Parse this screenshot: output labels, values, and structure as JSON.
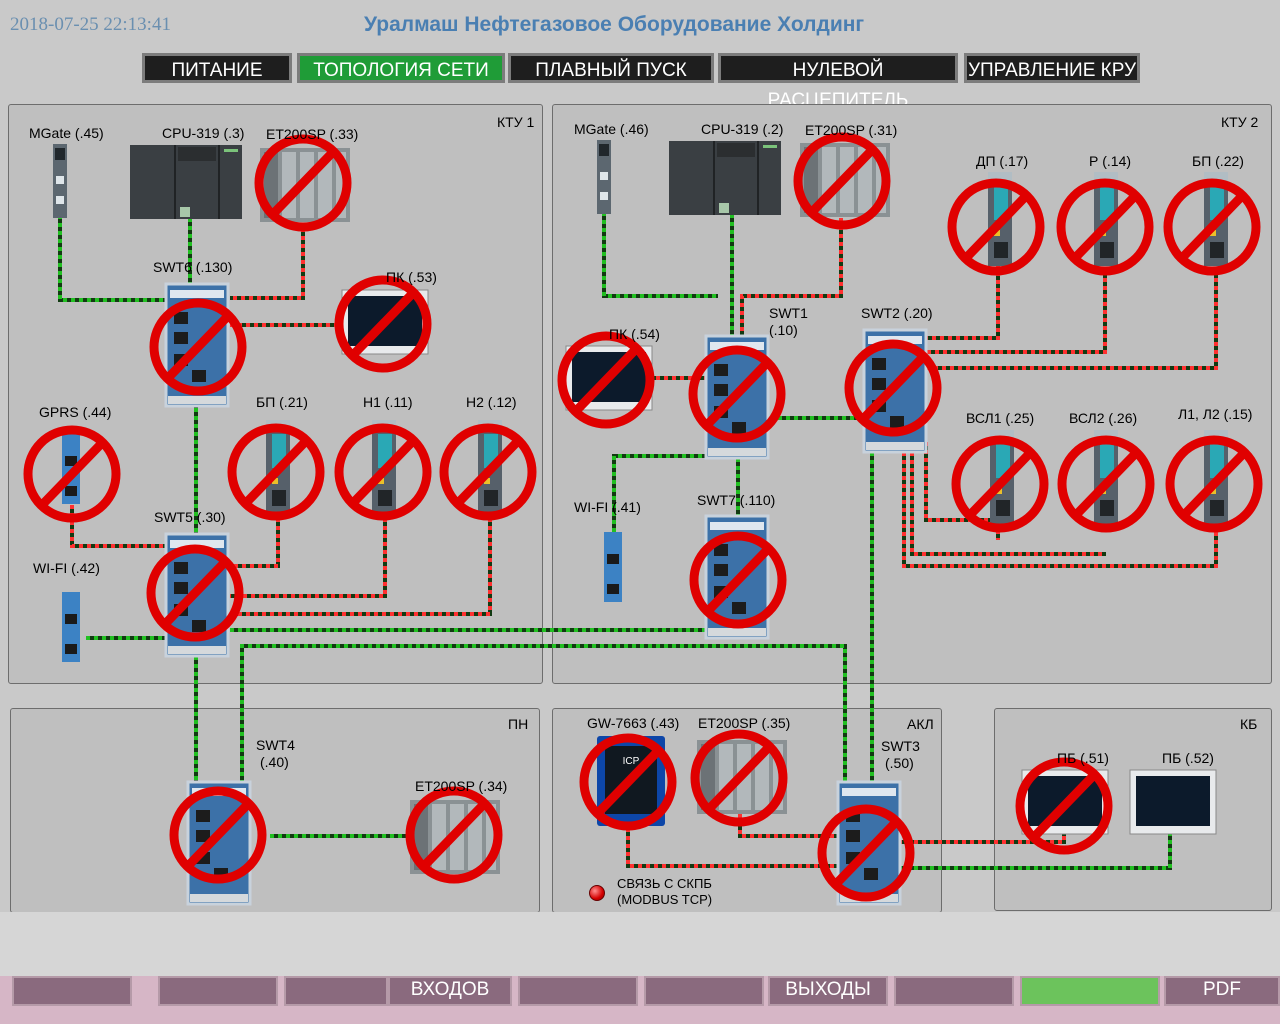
{
  "header": {
    "datetime": "2018-07-25 22:13:41",
    "title": "Уралмаш Нефтегазовое Оборудование Холдинг"
  },
  "nav": [
    {
      "label": "ПИТАНИЕ",
      "active": false
    },
    {
      "label": "ТОПОЛОГИЯ СЕТИ",
      "active": true
    },
    {
      "label": "ПЛАВНЫЙ ПУСК",
      "active": false
    },
    {
      "label": "НУЛЕВОЙ РАСЦЕПИТЕЛЬ",
      "active": false
    },
    {
      "label": "УПРАВЛЕНИЕ КРУ",
      "active": false
    }
  ],
  "panels": {
    "ktu1": "КТУ 1",
    "ktu2": "КТУ 2",
    "pn": "ПН",
    "akl": "АКЛ",
    "kb": "КБ"
  },
  "devices": {
    "mgate45": "MGate (.45)",
    "cpu3": "CPU-319 (.3)",
    "et33": "ET200SP (.33)",
    "swt6": "SWT6   (.130)",
    "pk53": "ПК (.53)",
    "gprs": "GPRS (.44)",
    "bp21": "БП (.21)",
    "h1": "Н1 (.11)",
    "h2": "Н2 (.12)",
    "swt5": "SWT5   (.30)",
    "wifi42": "WI-FI (.42)",
    "mgate46": "MGate (.46)",
    "cpu2": "CPU-319 (.2)",
    "et31": "ET200SP (.31)",
    "dp17": "ДП (.17)",
    "p14": "Р (.14)",
    "bp22": "БП (.22)",
    "pk54": "ПК (.54)",
    "swt1a": "SWT1",
    "swt1b": "(.10)",
    "swt2": "SWT2 (.20)",
    "vsl1": "ВСЛ1 (.25)",
    "vsl2": "ВСЛ2 (.26)",
    "l12": "Л1, Л2 (.15)",
    "wifi41": "WI-FI  (.41)",
    "swt7": "SWT7   (.110)",
    "swt4a": "SWT4",
    "swt4b": "(.40)",
    "et34": "ET200SP (.34)",
    "gw": "GW-7663 (.43)",
    "et35": "ET200SP (.35)",
    "swt3a": "SWT3",
    "swt3b": "(.50)",
    "pb51": "ПБ (.51)",
    "pb52": "ПБ (.52)"
  },
  "status": {
    "link_label_1": "СВЯЗЬ С СКПБ",
    "link_label_2": "(MODBUS TCP)",
    "link_color": "#d40000"
  },
  "bottom_buttons": [
    "ВХОДОВ",
    "ВЫХОДЫ",
    "PDF"
  ],
  "colors": {
    "active_tab": "#1f9c37",
    "title": "#4a7fb2",
    "cross": "#e00000"
  }
}
